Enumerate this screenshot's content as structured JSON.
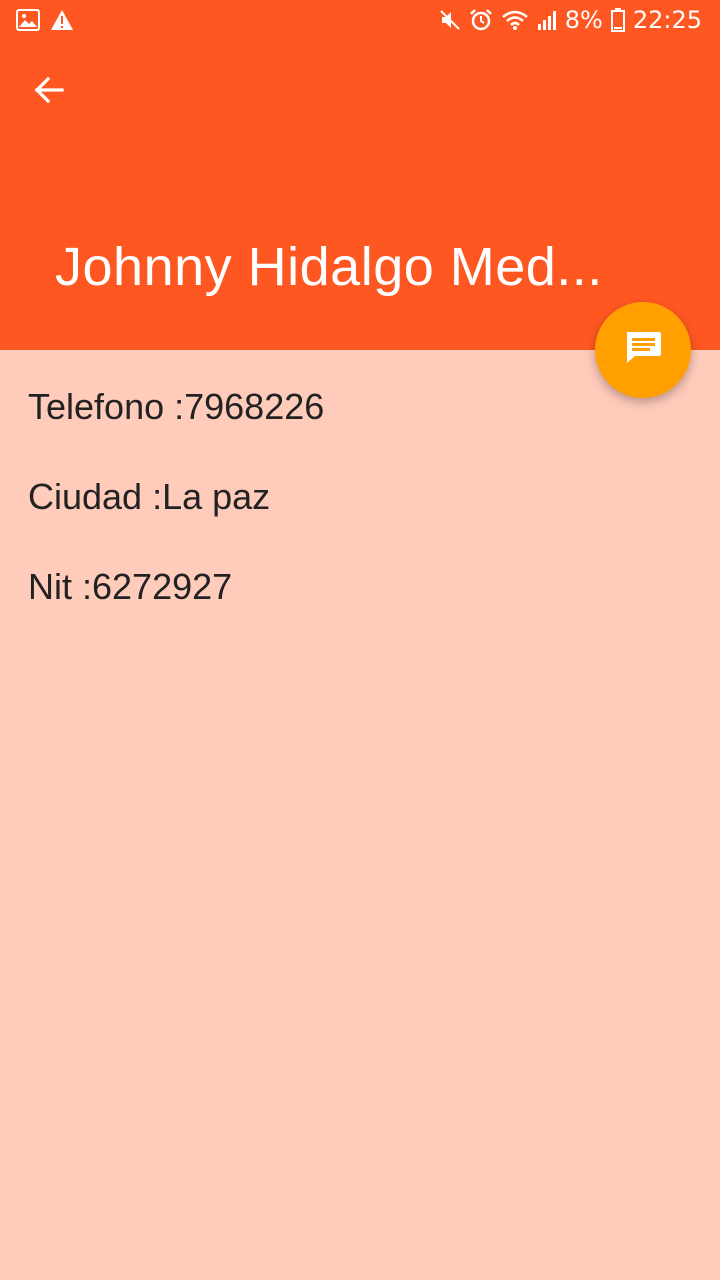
{
  "status_bar": {
    "left_icons": [
      "image-icon",
      "warning-icon"
    ],
    "right_icons": [
      "mute-icon",
      "alarm-icon",
      "wifi-icon",
      "signal-icon",
      "battery-icon"
    ],
    "battery": "8%",
    "time": "22:25"
  },
  "toolbar": {
    "back_icon": "arrow-left-icon",
    "title": "Johnny Hidalgo Med..."
  },
  "fab": {
    "icon": "message-icon"
  },
  "details": [
    {
      "label": "Telefono",
      "value": "7968226",
      "text": "Telefono :7968226"
    },
    {
      "label": "Ciudad",
      "value": "La paz",
      "text": "Ciudad :La paz"
    },
    {
      "label": "Nit",
      "value": "6272927",
      "text": "Nit :6272927"
    }
  ],
  "colors": {
    "appbar": "#FF5722",
    "background": "#FFCBBA",
    "fab": "#FFA000"
  }
}
